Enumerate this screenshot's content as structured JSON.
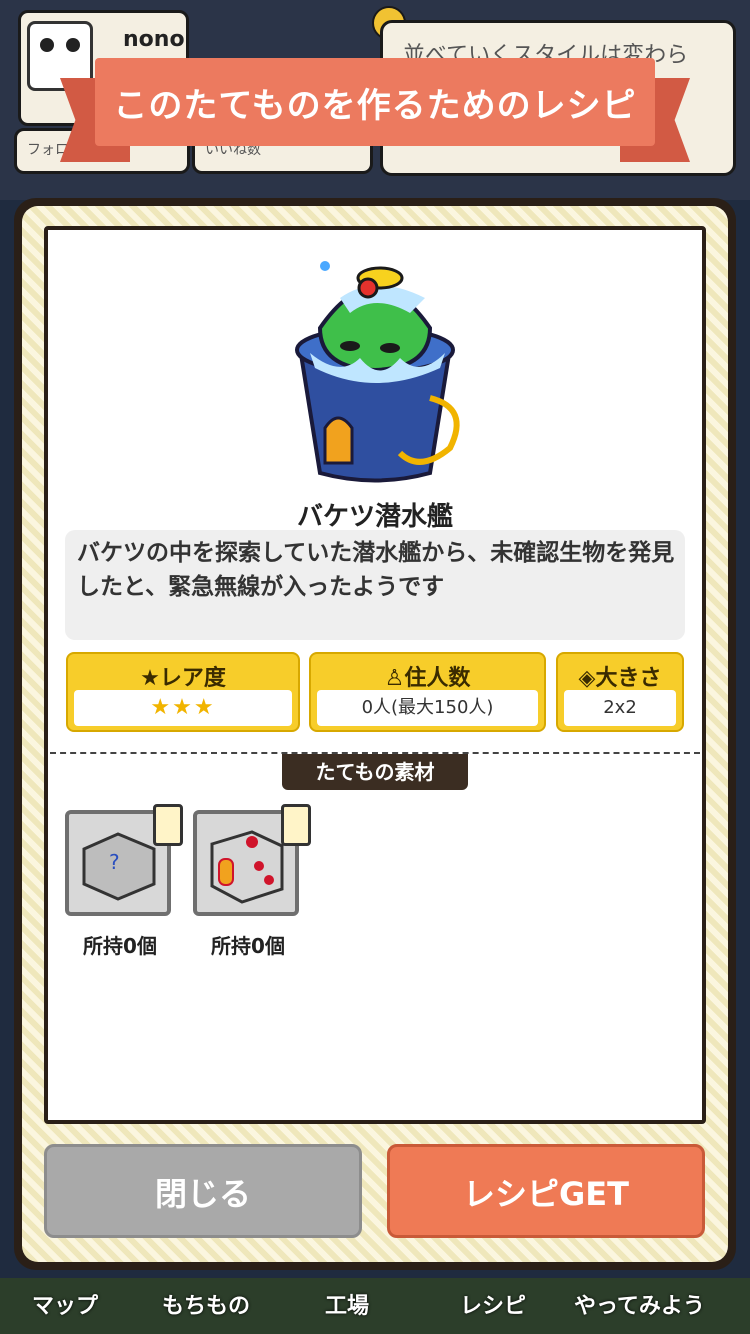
{
  "header": {
    "username": "nono",
    "follow_label": "フォロ",
    "likes_label": "いいね数",
    "message": "並べていくスタイルは変わら"
  },
  "banner": {
    "title": "このたてものを作るためのレシピ"
  },
  "building": {
    "name": "バケツ潜水艦",
    "description": "バケツの中を探索していた潜水艦から、未確認生物を発見したと、緊急無線が入ったようです"
  },
  "stats": {
    "rarity_label": "レア度",
    "rarity_stars": "★★★",
    "residents_label": "住人数",
    "residents_value": "0人(最大150人)",
    "size_label": "大きさ",
    "size_value": "2x2"
  },
  "materials": {
    "tab_label": "たてもの素材",
    "items": [
      {
        "count": "所持0個"
      },
      {
        "count": "所持0個"
      }
    ]
  },
  "buttons": {
    "close": "閉じる",
    "get": "レシピGET"
  },
  "nav": [
    "マップ",
    "もちもの",
    "工場",
    "レシピ",
    "やってみよう"
  ],
  "colors": {
    "banner": "#ec7a5f",
    "stat_yellow": "#f7cd2a",
    "get_button": "#ef7a55",
    "close_button": "#a9a9a9"
  }
}
